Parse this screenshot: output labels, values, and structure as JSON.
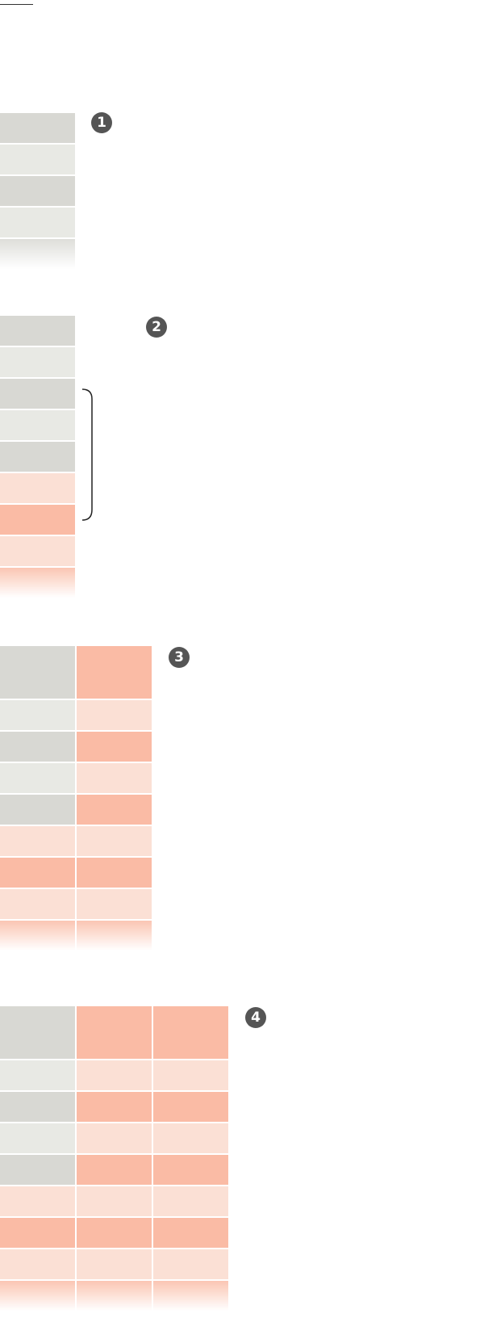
{
  "colors": {
    "gray_dark": "#d8d8d3",
    "gray_light": "#e8e9e4",
    "salmon_dark": "#fabba5",
    "salmon_light": "#fbe0d5",
    "marker_fill": "#555555",
    "bracket_stroke": "#222222"
  },
  "diagrams": [
    {
      "marker": "1",
      "columns": 1,
      "header": false,
      "rows": [
        [
          "gray_dark"
        ],
        [
          "gray_light"
        ],
        [
          "gray_dark"
        ],
        [
          "gray_light"
        ],
        [
          "gray_dark"
        ]
      ],
      "last_row_fades": true
    },
    {
      "marker": "2",
      "columns": 1,
      "header": false,
      "rows": [
        [
          "gray_dark"
        ],
        [
          "gray_light"
        ],
        [
          "gray_dark"
        ],
        [
          "gray_light"
        ],
        [
          "gray_dark"
        ],
        [
          "salmon_light"
        ],
        [
          "salmon_dark"
        ],
        [
          "salmon_light"
        ],
        [
          "salmon_dark"
        ]
      ],
      "last_row_fades": true,
      "bracket_rows": [
        2,
        6
      ]
    },
    {
      "marker": "3",
      "columns": 2,
      "header": true,
      "header_colors": [
        "gray_dark",
        "salmon_dark"
      ],
      "rows": [
        [
          "gray_light",
          "salmon_light"
        ],
        [
          "gray_dark",
          "salmon_dark"
        ],
        [
          "gray_light",
          "salmon_light"
        ],
        [
          "gray_dark",
          "salmon_dark"
        ],
        [
          "salmon_light",
          "salmon_light"
        ],
        [
          "salmon_dark",
          "salmon_dark"
        ],
        [
          "salmon_light",
          "salmon_light"
        ],
        [
          "salmon_dark",
          "salmon_dark"
        ]
      ],
      "last_row_fades": true
    },
    {
      "marker": "4",
      "columns": 3,
      "header": true,
      "header_colors": [
        "gray_dark",
        "salmon_dark",
        "salmon_dark"
      ],
      "rows": [
        [
          "gray_light",
          "salmon_light",
          "salmon_light"
        ],
        [
          "gray_dark",
          "salmon_dark",
          "salmon_dark"
        ],
        [
          "gray_light",
          "salmon_light",
          "salmon_light"
        ],
        [
          "gray_dark",
          "salmon_dark",
          "salmon_dark"
        ],
        [
          "salmon_light",
          "salmon_light",
          "salmon_light"
        ],
        [
          "salmon_dark",
          "salmon_dark",
          "salmon_dark"
        ],
        [
          "salmon_light",
          "salmon_light",
          "salmon_light"
        ],
        [
          "salmon_dark",
          "salmon_dark",
          "salmon_dark"
        ]
      ],
      "last_row_fades": true
    }
  ]
}
